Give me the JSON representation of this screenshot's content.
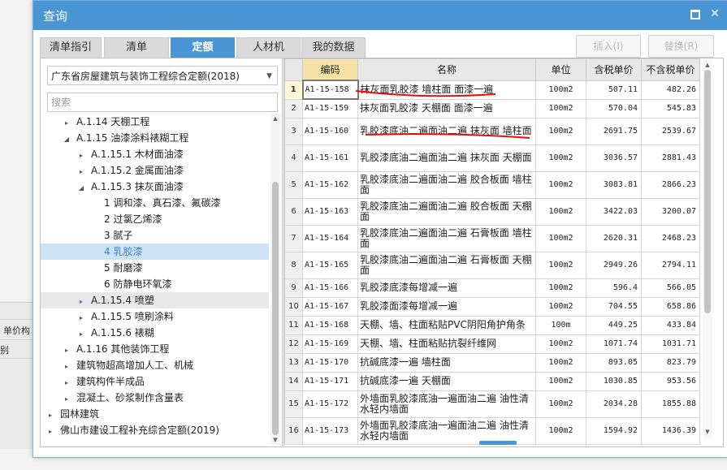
{
  "background": {
    "label_a": "单价构",
    "label_b": "别"
  },
  "dialog": {
    "title": "查询",
    "tabs": [
      {
        "label": "清单指引",
        "active": false
      },
      {
        "label": "清单",
        "active": false
      },
      {
        "label": "定额",
        "active": true
      },
      {
        "label": "人材机",
        "active": false
      },
      {
        "label": "我的数据",
        "active": false
      }
    ],
    "buttons": {
      "insert": "插入(I)",
      "replace": "替换(R)"
    }
  },
  "left": {
    "quota_library": "广东省房屋建筑与装饰工程综合定额(2018)",
    "search_placeholder": "搜索",
    "tree": [
      {
        "toggle": "▸",
        "text": "A.1.14 天棚工程",
        "level": 1
      },
      {
        "toggle": "◢",
        "text": "A.1.15 油漆涂料裱糊工程",
        "level": 1
      },
      {
        "toggle": "▸",
        "text": "A.1.15.1 木材面油漆",
        "level": 2
      },
      {
        "toggle": "▸",
        "text": "A.1.15.2 金属面油漆",
        "level": 2
      },
      {
        "toggle": "◢",
        "text": "A.1.15.3 抹灰面油漆",
        "level": 2
      },
      {
        "toggle": "",
        "text": "1 调和漆、真石漆、氟碳漆",
        "level": 3
      },
      {
        "toggle": "",
        "text": "2 过氯乙烯漆",
        "level": 3
      },
      {
        "toggle": "",
        "text": "3 腻子",
        "level": 3
      },
      {
        "toggle": "",
        "text": "4 乳胶漆",
        "level": 3,
        "selected": true
      },
      {
        "toggle": "",
        "text": "5 耐磨漆",
        "level": 3
      },
      {
        "toggle": "",
        "text": "6 防静电环氧漆",
        "level": 3
      },
      {
        "toggle": "▸",
        "text": "A.1.15.4 喷塑",
        "level": 2,
        "hover": true
      },
      {
        "toggle": "▸",
        "text": "A.1.15.5 喷刷涂料",
        "level": 2
      },
      {
        "toggle": "▸",
        "text": "A.1.15.6 裱糊",
        "level": 2
      },
      {
        "toggle": "▸",
        "text": "A.1.16 其他装饰工程",
        "level": 1
      },
      {
        "toggle": "▸",
        "text": "建筑物超高增加人工、机械",
        "level": 1
      },
      {
        "toggle": "▸",
        "text": "建筑构件半成品",
        "level": 1
      },
      {
        "toggle": "▸",
        "text": "混凝土、砂浆制作含量表",
        "level": 1
      },
      {
        "toggle": "▸",
        "text": "园林建筑",
        "level": 0
      },
      {
        "toggle": "▸",
        "text": "佛山市建设工程补充综合定额(2019)",
        "level": 0
      }
    ]
  },
  "grid": {
    "headers": [
      "",
      "编码",
      "名称",
      "单位",
      "含税单价",
      "不含税单价"
    ],
    "rows": [
      {
        "no": "1",
        "code": "A1-15-158",
        "name": "抹灰面乳胶漆 墙柱面 面漆一遍",
        "unit": "100m2",
        "tax": "507.11",
        "notax": "482.26"
      },
      {
        "no": "2",
        "code": "A1-15-159",
        "name": "抹灰面乳胶漆 天棚面 面漆一遍",
        "unit": "100m2",
        "tax": "570.04",
        "notax": "545.83"
      },
      {
        "no": "3",
        "code": "A1-15-160",
        "name": "乳胶漆底油二遍面油二遍 抹灰面 墙柱面",
        "unit": "100m2",
        "tax": "2691.75",
        "notax": "2539.67"
      },
      {
        "no": "4",
        "code": "A1-15-161",
        "name": "乳胶漆底油二遍面油二遍 抹灰面 天棚面",
        "unit": "100m2",
        "tax": "3036.57",
        "notax": "2881.43"
      },
      {
        "no": "5",
        "code": "A1-15-162",
        "name": "乳胶漆底油二遍面油二遍 胶合板面 墙柱面",
        "unit": "100m2",
        "tax": "3083.81",
        "notax": "2866.23"
      },
      {
        "no": "6",
        "code": "A1-15-163",
        "name": "乳胶漆底油二遍面油二遍 胶合板面 天棚面",
        "unit": "100m2",
        "tax": "3422.03",
        "notax": "3200.07"
      },
      {
        "no": "7",
        "code": "A1-15-164",
        "name": "乳胶漆底油二遍面油二遍 石膏板面 墙柱面",
        "unit": "100m2",
        "tax": "2620.31",
        "notax": "2468.23"
      },
      {
        "no": "8",
        "code": "A1-15-165",
        "name": "乳胶漆底油二遍面油二遍 石膏板面 天棚面",
        "unit": "100m2",
        "tax": "2949.26",
        "notax": "2794.11"
      },
      {
        "no": "9",
        "code": "A1-15-166",
        "name": "乳胶漆底漆每增减一遍",
        "unit": "100m2",
        "tax": "596.4",
        "notax": "566.05"
      },
      {
        "no": "10",
        "code": "A1-15-167",
        "name": "乳胶漆面漆每增减一遍",
        "unit": "100m2",
        "tax": "704.55",
        "notax": "658.86"
      },
      {
        "no": "11",
        "code": "A1-15-168",
        "name": "天棚、墙、柱面粘贴PVC阴阳角护角条",
        "unit": "100m",
        "tax": "449.25",
        "notax": "433.84"
      },
      {
        "no": "12",
        "code": "A1-15-169",
        "name": "天棚、墙、柱面粘贴抗裂纤维网",
        "unit": "100m2",
        "tax": "1071.74",
        "notax": "1031.71"
      },
      {
        "no": "13",
        "code": "A1-15-170",
        "name": "抗碱底漆一遍 墙柱面",
        "unit": "100m2",
        "tax": "893.05",
        "notax": "823.79"
      },
      {
        "no": "14",
        "code": "A1-15-171",
        "name": "抗碱底漆一遍 天棚面",
        "unit": "100m2",
        "tax": "1030.85",
        "notax": "953.56"
      },
      {
        "no": "15",
        "code": "A1-15-172",
        "name": "外墙面乳胶漆底油一遍面油二遍 油性清水轻内墙面",
        "unit": "100m2",
        "tax": "2034.28",
        "notax": "1855.88"
      },
      {
        "no": "16",
        "code": "A1-15-173",
        "name": "外墙面乳胶漆底油一遍面油二遍 油性清水轻内墙面",
        "unit": "100m2",
        "tax": "1594.92",
        "notax": "1436.39"
      }
    ]
  },
  "colors": {
    "accent": "#4a95d4",
    "annotation": "#e01010"
  }
}
